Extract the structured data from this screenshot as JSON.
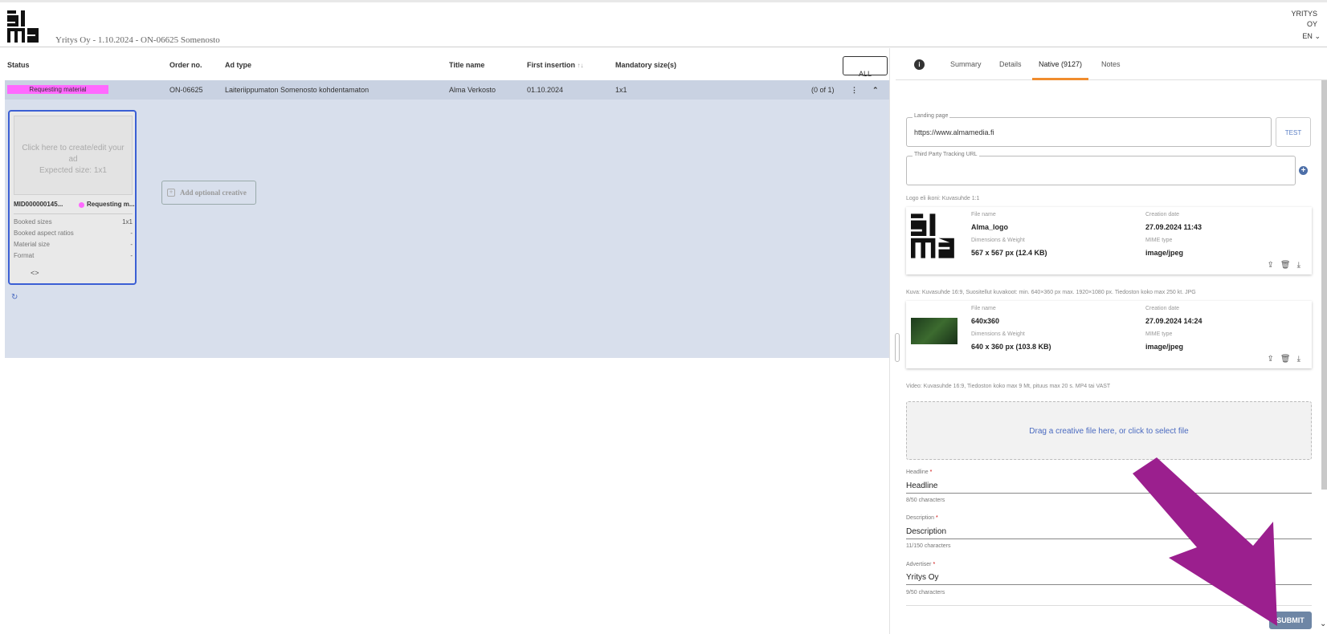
{
  "header": {
    "subtitle": "Yritys Oy - 1.10.2024 - ON-06625 Somenosto",
    "company_line1": "YRITYS",
    "company_line2": "OY",
    "language": "EN"
  },
  "table": {
    "columns": {
      "status": "Status",
      "order_no": "Order no.",
      "ad_type": "Ad type",
      "title_name": "Title name",
      "first_insertion": "First insertion",
      "mandatory_sizes": "Mandatory size(s)"
    },
    "all_button": "ALL",
    "row": {
      "status": "Requesting material",
      "order_no": "ON-06625",
      "ad_type": "Laiteriippumaton Somenosto kohdentamaton",
      "title_name": "Alma Verkosto",
      "first_insertion": "01.10.2024",
      "mandatory_size": "1x1",
      "count": "(0 of 1)"
    }
  },
  "card": {
    "placeholder_line1": "Click here to create/edit your",
    "placeholder_line2": "ad",
    "placeholder_line3": "Expected size: 1x1",
    "id": "MID000000145...",
    "status": "Requesting m...",
    "booked_sizes_label": "Booked sizes",
    "booked_sizes_value": "1x1",
    "aspect_label": "Booked aspect ratios",
    "aspect_value": "-",
    "material_size_label": "Material size",
    "material_size_value": "-",
    "format_label": "Format",
    "format_value": "-",
    "code_icon": "<>"
  },
  "add_optional": "Add optional creative",
  "tabs": {
    "summary": "Summary",
    "details": "Details",
    "native": "Native (9127)",
    "notes": "Notes"
  },
  "form": {
    "landing_label": "Landing page",
    "landing_value": "https://www.almamedia.fi",
    "test_button": "TEST",
    "tracking_label": "Third Party Tracking URL",
    "logo_hint": "Logo eli ikoni: Kuvasuhde 1:1",
    "image_hint": "Kuva: Kuvasuhde 16:9, Suositellut kuvakoot: min. 640×360 px max. 1920×1080 px. Tiedoston koko max 250 kt. JPG",
    "video_hint": "Video: Kuvasuhde 16:9, Tiedoston koko max 9 Mt, pituus max 20 s. MP4 tai VAST",
    "dropzone": "Drag a creative file here, or click to select file",
    "headline_label": "Headline",
    "headline_value": "Headline",
    "headline_count": "8/50 characters",
    "description_label": "Description",
    "description_value": "Description",
    "description_count": "11/150 characters",
    "advertiser_label": "Advertiser",
    "advertiser_value": "Yritys Oy",
    "advertiser_count": "9/50 characters",
    "required_mark": "*",
    "submit": "SUBMIT"
  },
  "assets": [
    {
      "file_name_label": "File name",
      "file_name": "Alma_logo",
      "creation_label": "Creation date",
      "creation": "27.09.2024 11:43",
      "dims_label": "Dimensions & Weight",
      "dims": "567 x 567 px (12.4 KB)",
      "mime_label": "MIME type",
      "mime": "image/jpeg"
    },
    {
      "file_name_label": "File name",
      "file_name": "640x360",
      "creation_label": "Creation date",
      "creation": "27.09.2024 14:24",
      "dims_label": "Dimensions & Weight",
      "dims": "640 x 360 px (103.8 KB)",
      "mime_label": "MIME type",
      "mime": "image/jpeg"
    }
  ],
  "colors": {
    "status_pink": "#ff69ff",
    "row_blue": "#c9d2e2",
    "accent_orange": "#f08c2e",
    "arrow_purple": "#9b1f8e",
    "submit_blue": "#6e86a5"
  }
}
